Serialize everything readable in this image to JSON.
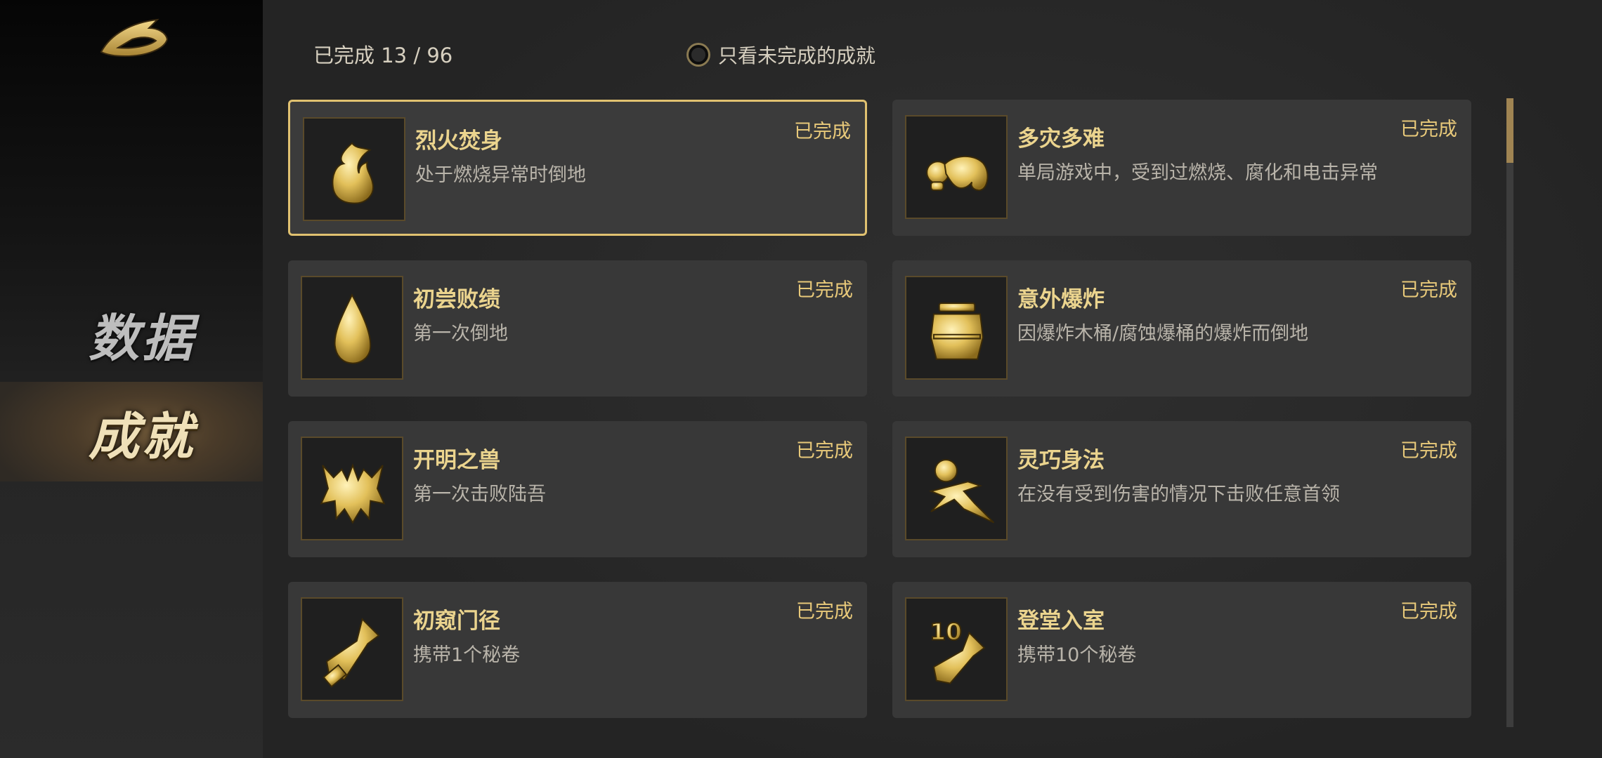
{
  "sidebar": {
    "nav": [
      {
        "label": "数据",
        "selected": false
      },
      {
        "label": "成就",
        "selected": true
      }
    ]
  },
  "header": {
    "progress": "已完成 13 / 96",
    "completed_count": 13,
    "total_count": 96,
    "filter_label": "只看未完成的成就",
    "filter_checked": false
  },
  "achievements": [
    {
      "title": "烈火焚身",
      "desc": "处于燃烧异常时倒地",
      "status": "已完成",
      "icon": "flame-icon"
    },
    {
      "title": "多灾多难",
      "desc": "单局游戏中，受到过燃烧、腐化和电击异常",
      "status": "已完成",
      "icon": "crawling-figure-icon"
    },
    {
      "title": "初尝败绩",
      "desc": "第一次倒地",
      "status": "已完成",
      "icon": "drop-icon"
    },
    {
      "title": "意外爆炸",
      "desc": "因爆炸木桶/腐蚀爆桶的爆炸而倒地",
      "status": "已完成",
      "icon": "barrel-icon"
    },
    {
      "title": "开明之兽",
      "desc": "第一次击败陆吾",
      "status": "已完成",
      "icon": "beast-mask-icon"
    },
    {
      "title": "灵巧身法",
      "desc": "在没有受到伤害的情况下击败任意首领",
      "status": "已完成",
      "icon": "dodging-figure-icon"
    },
    {
      "title": "初窥门径",
      "desc": "携带1个秘卷",
      "status": "已完成",
      "icon": "scroll-icon"
    },
    {
      "title": "登堂入室",
      "desc": "携带10个秘卷",
      "status": "已完成",
      "icon": "scroll-ten-icon"
    }
  ],
  "scroll": {
    "position": 0.0
  },
  "colors": {
    "accent": "#e0c170",
    "card_bg": "#383838",
    "title": "#ebd48e",
    "status": "#e8c97a"
  }
}
